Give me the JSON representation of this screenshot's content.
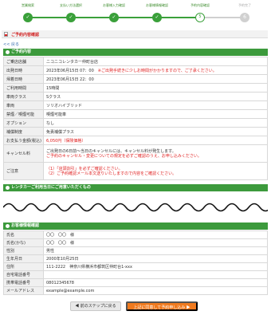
{
  "steps": [
    {
      "label": "営業検索",
      "icon": "check-icon"
    },
    {
      "label": "支払い方法選択",
      "icon": "check-icon"
    },
    {
      "label": "お客様入力確認",
      "icon": "check-icon"
    },
    {
      "label": "お客様情報確認",
      "icon": "check-icon"
    },
    {
      "label": "予約内容確認",
      "number": "5"
    },
    {
      "label": "予約完了",
      "number": "6"
    }
  ],
  "page_title": "ご予約内容確認",
  "back_link": "<< 戻る",
  "reservation": {
    "heading": "ご予約内容",
    "rows": [
      {
        "label": "ご乗店店舗",
        "value": "ニコニコレンタカー仲町台店"
      },
      {
        "label": "出発日時",
        "value": "2023年06月15日 07：00",
        "note": "※ご出発手続きに少しお時間がかかりますので、ご了承ください。"
      },
      {
        "label": "帰着日時",
        "value": "2023年06月15日 22：00"
      },
      {
        "label": "ご利用時間",
        "value": "15時間"
      },
      {
        "label": "車両クラス",
        "value": "Sクラス"
      },
      {
        "label": "車両",
        "value": "ソリオハイブリッド"
      },
      {
        "label": "禁煙／喫煙可能",
        "value": "喫煙可能車"
      },
      {
        "label": "オプション",
        "value": "なし"
      },
      {
        "label": "補償制度",
        "value": "免責補償プラス"
      },
      {
        "label": "お支払う金額(税込)",
        "value": "6,050円（保険価格）"
      }
    ],
    "cancel_label": "キャンセル料",
    "cancel_text_1": "ご出発日の6日前〜当日のキャンセルには、キャンセル料が発生します。",
    "cancel_text_2": "ご予約のキャンセル・変更についての規定を必ずご確認のうえ、お申し込みください。",
    "notes_label": "ご注意",
    "notes_1": "（1）「店頭割引」を必ずご確認ください。",
    "notes_2": "（2）ご予約確認メール本文送りいたしますので内容をご確認ください。"
  },
  "rental_section": {
    "heading": "レンタカーご利用当日にご用意いただくもの"
  },
  "customer": {
    "heading": "お客様情報確認",
    "rows": [
      {
        "label": "氏名",
        "value": "〇〇　〇〇　様"
      },
      {
        "label": "氏名(かな)",
        "value": "〇〇　〇〇　様"
      },
      {
        "label": "性別",
        "value": "男性"
      },
      {
        "label": "生年月日",
        "value": "2000年10月25日"
      },
      {
        "label": "住所",
        "value": "111-2222　神奈川県横浜市都筑区仲町台1-xxx"
      },
      {
        "label": "自宅電話番号",
        "value": ""
      },
      {
        "label": "携帯電話番号",
        "value": "08012345678"
      },
      {
        "label": "メールアドレス",
        "value": "example@example.com"
      }
    ]
  },
  "buttons": {
    "prev": "◀ 前のステップに戻る",
    "submit": "上記に同意して予約申し込み ▶"
  },
  "colors": {
    "accent": "#3c9a3c",
    "alert": "#e02020",
    "cta": "#f07a1e"
  }
}
